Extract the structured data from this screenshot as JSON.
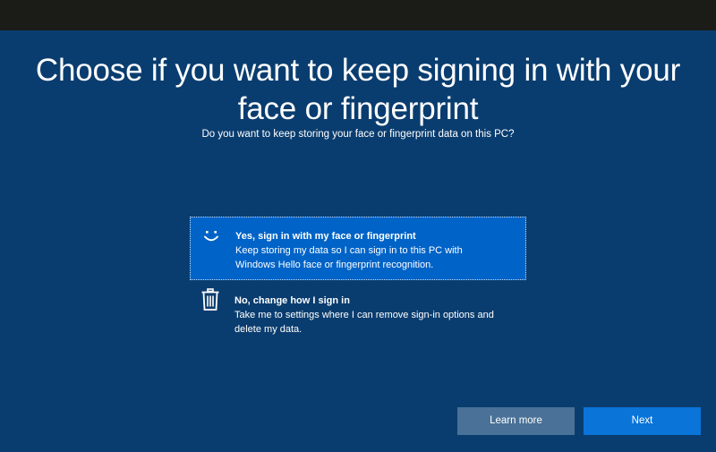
{
  "page": {
    "title_line1": "Choose if you want to keep signing in with your",
    "title_line2": "face or fingerprint",
    "subtitle": "Do you want to keep storing your face or fingerprint data on this PC?"
  },
  "options": [
    {
      "icon": "smiley-face-icon",
      "heading": "Yes, sign in with my face or fingerprint",
      "desc_line1": "Keep storing my data so I can sign in to this PC with",
      "desc_line2": "Windows Hello face or fingerprint recognition.",
      "selected": true
    },
    {
      "icon": "trash-can-icon",
      "heading": "No, change how I sign in",
      "desc_line1": "Take me to settings where I can remove sign-in options and",
      "desc_line2": "delete my data.",
      "selected": false
    }
  ],
  "buttons": {
    "learn_more": "Learn more",
    "next": "Next"
  },
  "colors": {
    "background": "#0a3d6f",
    "selected_option": "#0063c7",
    "learn_more_button": "#4a7197",
    "next_button": "#0a74d9"
  }
}
